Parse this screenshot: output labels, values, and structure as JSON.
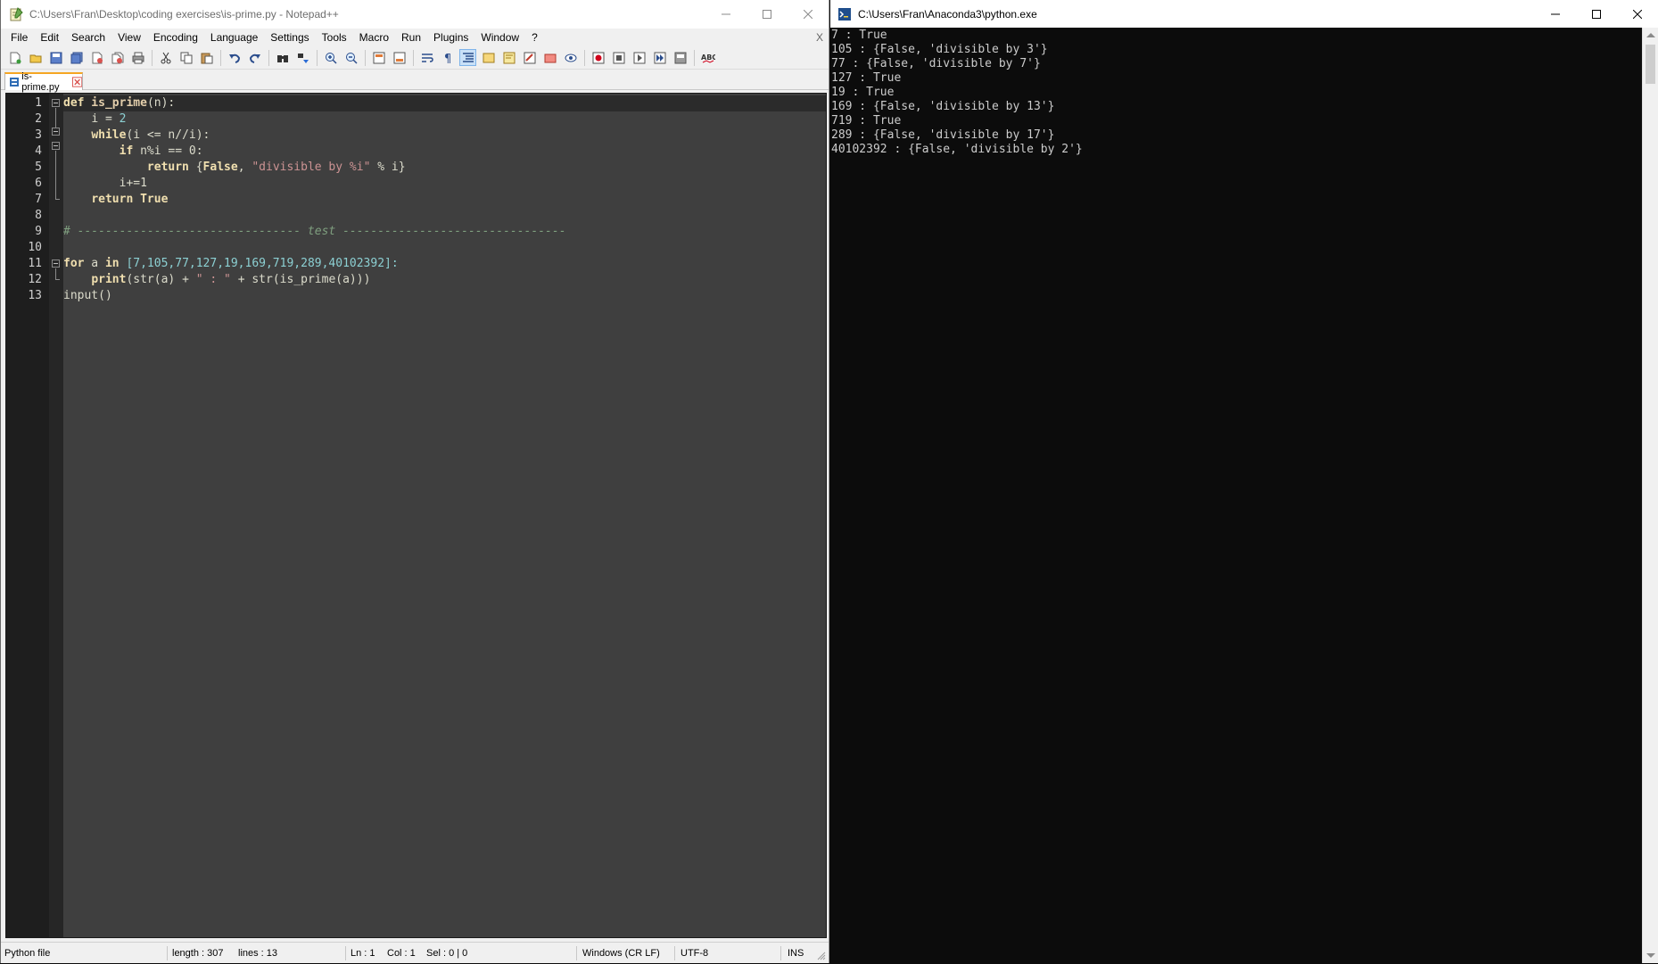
{
  "editor_window": {
    "title": "C:\\Users\\Fran\\Desktop\\coding exercises\\is-prime.py - Notepad++",
    "menu": [
      "File",
      "Edit",
      "Search",
      "View",
      "Encoding",
      "Language",
      "Settings",
      "Tools",
      "Macro",
      "Run",
      "Plugins",
      "Window",
      "?"
    ],
    "close_doc": "X",
    "tab": {
      "label": "is-prime.py"
    },
    "line_numbers": [
      "1",
      "2",
      "3",
      "4",
      "5",
      "6",
      "7",
      "8",
      "9",
      "10",
      "11",
      "12",
      "13"
    ],
    "code": {
      "l1": {
        "kw": "def",
        "name": " is_prime",
        "rest": "(n):"
      },
      "l2": {
        "indent": "    ",
        "a": "i ",
        "op": "=",
        "num": " 2"
      },
      "l3": {
        "indent": "    ",
        "kw": "while",
        "rest": "(i <= n//i):"
      },
      "l4": {
        "indent": "        ",
        "kw": "if",
        "rest": " n%i == 0:"
      },
      "l5": {
        "indent": "            ",
        "kw": "return",
        "a": " {",
        "kw2": "False",
        "b": ", ",
        "str": "\"divisible by %i\"",
        "c": " % i}"
      },
      "l6": {
        "indent": "        ",
        "rest": "i+=1"
      },
      "l7": {
        "indent": "    ",
        "kw": "return",
        "kw2": " True"
      },
      "l9": "# -------------------------------- test --------------------------------",
      "l11": {
        "kw": "for",
        "a": " a ",
        "kw2": "in",
        "list": " [7,105,77,127,19,169,719,289,40102392]:"
      },
      "l12": {
        "indent": "    ",
        "kw": "print",
        "rest": "(str(a) + ",
        "str": "\" : \"",
        "rest2": " + str(is_prime(a)))"
      },
      "l13": "input()"
    },
    "status": {
      "filetype": "Python file",
      "length": "length : 307",
      "lines": "lines : 13",
      "ln": "Ln : 1",
      "col": "Col : 1",
      "sel": "Sel : 0 | 0",
      "eol": "Windows (CR LF)",
      "encoding": "UTF-8",
      "mode": "INS"
    }
  },
  "console_window": {
    "title": "C:\\Users\\Fran\\Anaconda3\\python.exe",
    "output": [
      "7 : True",
      "105 : {False, 'divisible by 3'}",
      "77 : {False, 'divisible by 7'}",
      "127 : True",
      "19 : True",
      "169 : {False, 'divisible by 13'}",
      "719 : True",
      "289 : {False, 'divisible by 17'}",
      "40102392 : {False, 'divisible by 2'}"
    ]
  },
  "colors": {
    "editor_bg": "#3f3f3f",
    "gutter_bg": "#1e1e1e",
    "console_bg": "#0c0c0c",
    "console_text": "#cccccc",
    "tab_accent": "#f5a623"
  },
  "icons": {
    "toolbar": [
      "new-file-icon",
      "open-file-icon",
      "save-icon",
      "save-all-icon",
      "close-icon",
      "close-all-icon",
      "print-icon",
      "cut-icon",
      "copy-icon",
      "paste-icon",
      "undo-icon",
      "redo-icon",
      "find-icon",
      "replace-icon",
      "zoom-in-icon",
      "zoom-out-icon",
      "sync-vertical-icon",
      "sync-horizontal-icon",
      "word-wrap-icon",
      "show-all-chars-icon",
      "indent-guide-icon",
      "lang-udl-icon",
      "doc-map-icon",
      "function-list-icon",
      "folder-workspace-icon",
      "monitoring-icon",
      "record-macro-icon",
      "stop-record-icon",
      "play-macro-icon",
      "run-multiple-icon",
      "save-macro-icon",
      "spell-check-icon"
    ]
  }
}
